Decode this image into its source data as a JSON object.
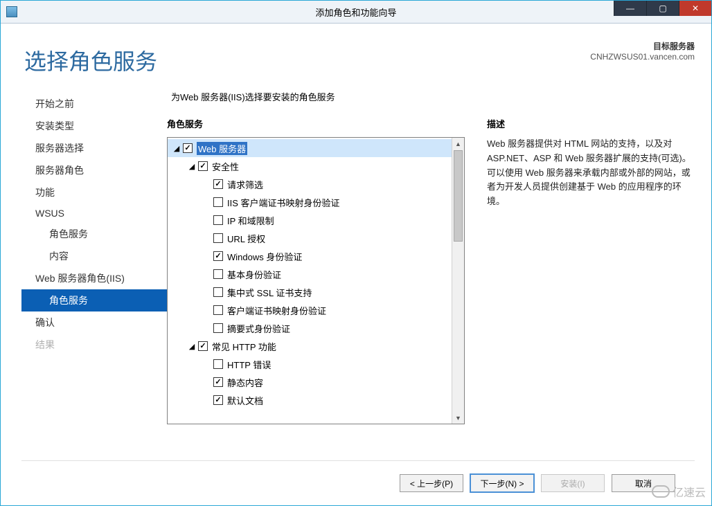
{
  "window": {
    "title": "添加角色和功能向导"
  },
  "header": {
    "page_title": "选择角色服务",
    "target_label": "目标服务器",
    "target_value": "CNHZWSUS01.vancen.com"
  },
  "sidebar": {
    "items": [
      {
        "label": "开始之前",
        "indent": 0,
        "selected": false,
        "disabled": false
      },
      {
        "label": "安装类型",
        "indent": 0,
        "selected": false,
        "disabled": false
      },
      {
        "label": "服务器选择",
        "indent": 0,
        "selected": false,
        "disabled": false
      },
      {
        "label": "服务器角色",
        "indent": 0,
        "selected": false,
        "disabled": false
      },
      {
        "label": "功能",
        "indent": 0,
        "selected": false,
        "disabled": false
      },
      {
        "label": "WSUS",
        "indent": 0,
        "selected": false,
        "disabled": false
      },
      {
        "label": "角色服务",
        "indent": 1,
        "selected": false,
        "disabled": false
      },
      {
        "label": "内容",
        "indent": 1,
        "selected": false,
        "disabled": false
      },
      {
        "label": "Web 服务器角色(IIS)",
        "indent": 0,
        "selected": false,
        "disabled": false
      },
      {
        "label": "角色服务",
        "indent": 1,
        "selected": true,
        "disabled": false
      },
      {
        "label": "确认",
        "indent": 0,
        "selected": false,
        "disabled": false
      },
      {
        "label": "结果",
        "indent": 0,
        "selected": false,
        "disabled": true
      }
    ]
  },
  "main": {
    "instruction": "为Web 服务器(IIS)选择要安装的角色服务",
    "tree_heading": "角色服务",
    "desc_heading": "描述",
    "description": "Web 服务器提供对 HTML 网站的支持，以及对 ASP.NET、ASP 和 Web 服务器扩展的支持(可选)。可以使用 Web 服务器来承载内部或外部的网站，或者为开发人员提供创建基于 Web 的应用程序的环境。"
  },
  "tree": [
    {
      "depth": 0,
      "expander": "open",
      "checked": true,
      "selected": true,
      "label": "Web 服务器"
    },
    {
      "depth": 1,
      "expander": "open",
      "checked": true,
      "selected": false,
      "label": "安全性"
    },
    {
      "depth": 2,
      "expander": "none",
      "checked": true,
      "selected": false,
      "label": "请求筛选"
    },
    {
      "depth": 2,
      "expander": "none",
      "checked": false,
      "selected": false,
      "label": "IIS 客户端证书映射身份验证"
    },
    {
      "depth": 2,
      "expander": "none",
      "checked": false,
      "selected": false,
      "label": "IP 和域限制"
    },
    {
      "depth": 2,
      "expander": "none",
      "checked": false,
      "selected": false,
      "label": "URL 授权"
    },
    {
      "depth": 2,
      "expander": "none",
      "checked": true,
      "selected": false,
      "label": "Windows 身份验证"
    },
    {
      "depth": 2,
      "expander": "none",
      "checked": false,
      "selected": false,
      "label": "基本身份验证"
    },
    {
      "depth": 2,
      "expander": "none",
      "checked": false,
      "selected": false,
      "label": "集中式 SSL 证书支持"
    },
    {
      "depth": 2,
      "expander": "none",
      "checked": false,
      "selected": false,
      "label": "客户端证书映射身份验证"
    },
    {
      "depth": 2,
      "expander": "none",
      "checked": false,
      "selected": false,
      "label": "摘要式身份验证"
    },
    {
      "depth": 1,
      "expander": "open",
      "checked": true,
      "selected": false,
      "label": "常见 HTTP 功能"
    },
    {
      "depth": 2,
      "expander": "none",
      "checked": false,
      "selected": false,
      "label": "HTTP 错误"
    },
    {
      "depth": 2,
      "expander": "none",
      "checked": true,
      "selected": false,
      "label": "静态内容"
    },
    {
      "depth": 2,
      "expander": "none",
      "checked": true,
      "selected": false,
      "label": "默认文档"
    }
  ],
  "buttons": {
    "prev": "< 上一步(P)",
    "next": "下一步(N) >",
    "install": "安装(I)",
    "cancel": "取消"
  },
  "watermark": "亿速云"
}
